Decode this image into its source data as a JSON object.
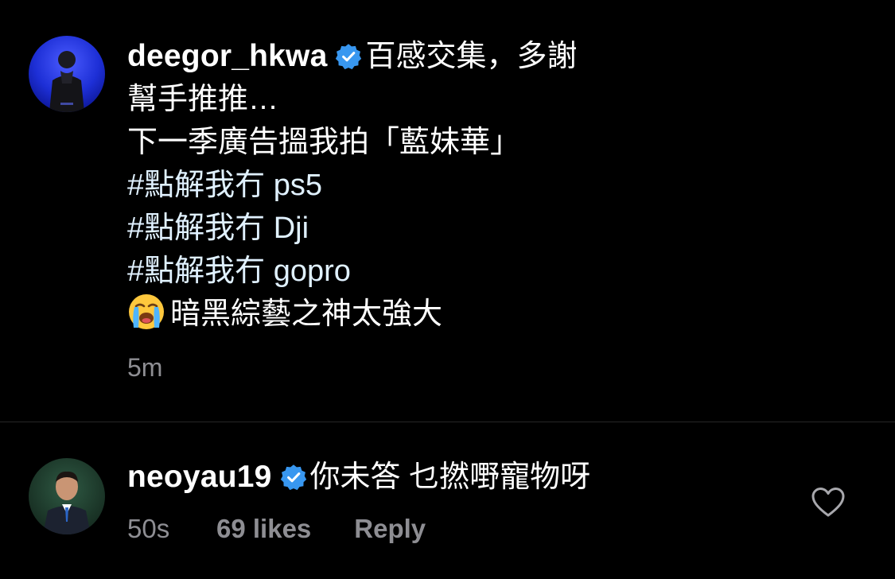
{
  "colors": {
    "background": "#000000",
    "text": "#ffffff",
    "secondary": "#8e8e93",
    "verified_badge": "#3897f0",
    "divider": "#262626"
  },
  "caption": {
    "username": "deegor_hkwa",
    "verified": true,
    "text_first_line": "百感交集，多謝",
    "lines": [
      "幫手推推…",
      "下一季廣告搵我拍「藍妹華」",
      "#點解我冇 ps5",
      "#點解我冇 Dji",
      "#點解我冇 gopro"
    ],
    "emoji_icon": "loudly-crying-face-emoji",
    "last_line": "暗黑綜藝之神太強大",
    "timestamp": "5m"
  },
  "comment": {
    "username": "neoyau19",
    "verified": true,
    "text": "你未答 乜撚嘢寵物呀",
    "timestamp": "50s",
    "likes": "69 likes",
    "reply_label": "Reply",
    "like_icon": "heart-outline-icon"
  }
}
